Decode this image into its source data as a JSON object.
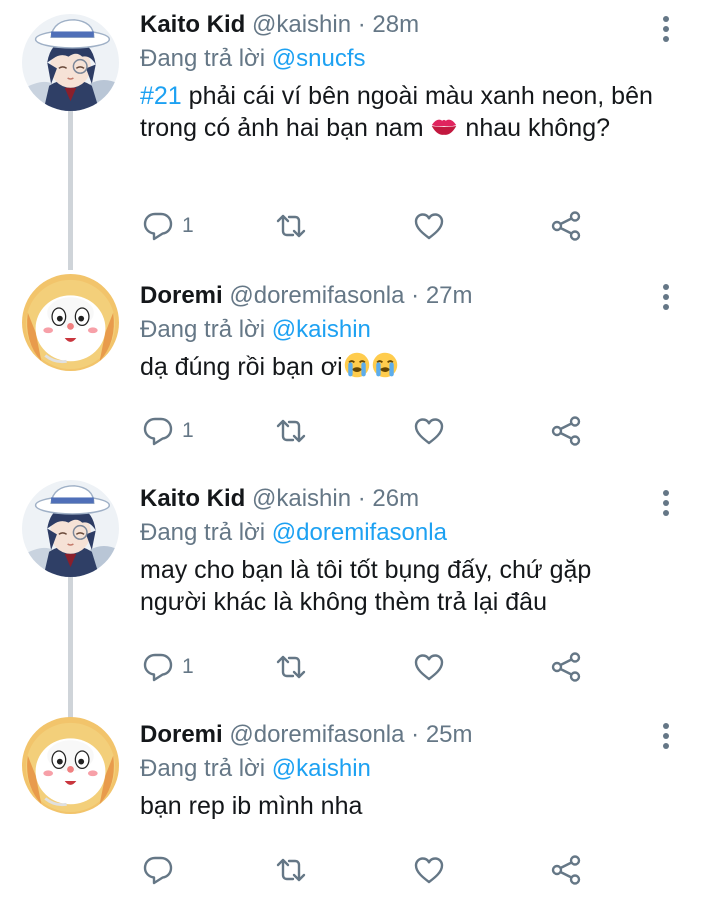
{
  "tweets": [
    {
      "name": "Kaito Kid",
      "handle": "@kaishin",
      "dot": " · ",
      "time": "28m",
      "reply_prefix": "Đang trả lời ",
      "reply_to": "@snucfs",
      "hashtag": "#21",
      "text_part1": " phải cái ví bên ngoài màu xanh neon, bên trong có ảnh hai bạn nam ",
      "emoji": "kiss-lips-emoji",
      "text_part2": " nhau không?",
      "reply_count": "1",
      "avatar": "kaito-kid-avatar"
    },
    {
      "name": "Doremi",
      "handle": "@doremifasonla",
      "dot": " · ",
      "time": "27m",
      "reply_prefix": "Đang trả lời ",
      "reply_to": "@kaishin",
      "text": "dạ đúng rồi bạn ơi",
      "emoji": "crying-face-emoji",
      "reply_count": "1",
      "avatar": "doremi-avatar"
    },
    {
      "name": "Kaito Kid",
      "handle": "@kaishin",
      "dot": " · ",
      "time": "26m",
      "reply_prefix": "Đang trả lời ",
      "reply_to": "@doremifasonla",
      "text": "may cho bạn là tôi tốt bụng đấy, chứ gặp người khác là không thèm trả lại đâu",
      "reply_count": "1",
      "avatar": "kaito-kid-avatar"
    },
    {
      "name": "Doremi",
      "handle": "@doremifasonla",
      "dot": " · ",
      "time": "25m",
      "reply_prefix": "Đang trả lời ",
      "reply_to": "@kaishin",
      "text": "bạn rep ib mình nha",
      "reply_count": "",
      "avatar": "doremi-avatar"
    }
  ],
  "colors": {
    "accent": "#1da1f2",
    "muted": "#657786",
    "thread_line": "#cfd4d9"
  },
  "icons": [
    "reply-icon",
    "retweet-icon",
    "like-icon",
    "share-icon",
    "more-options-icon"
  ]
}
